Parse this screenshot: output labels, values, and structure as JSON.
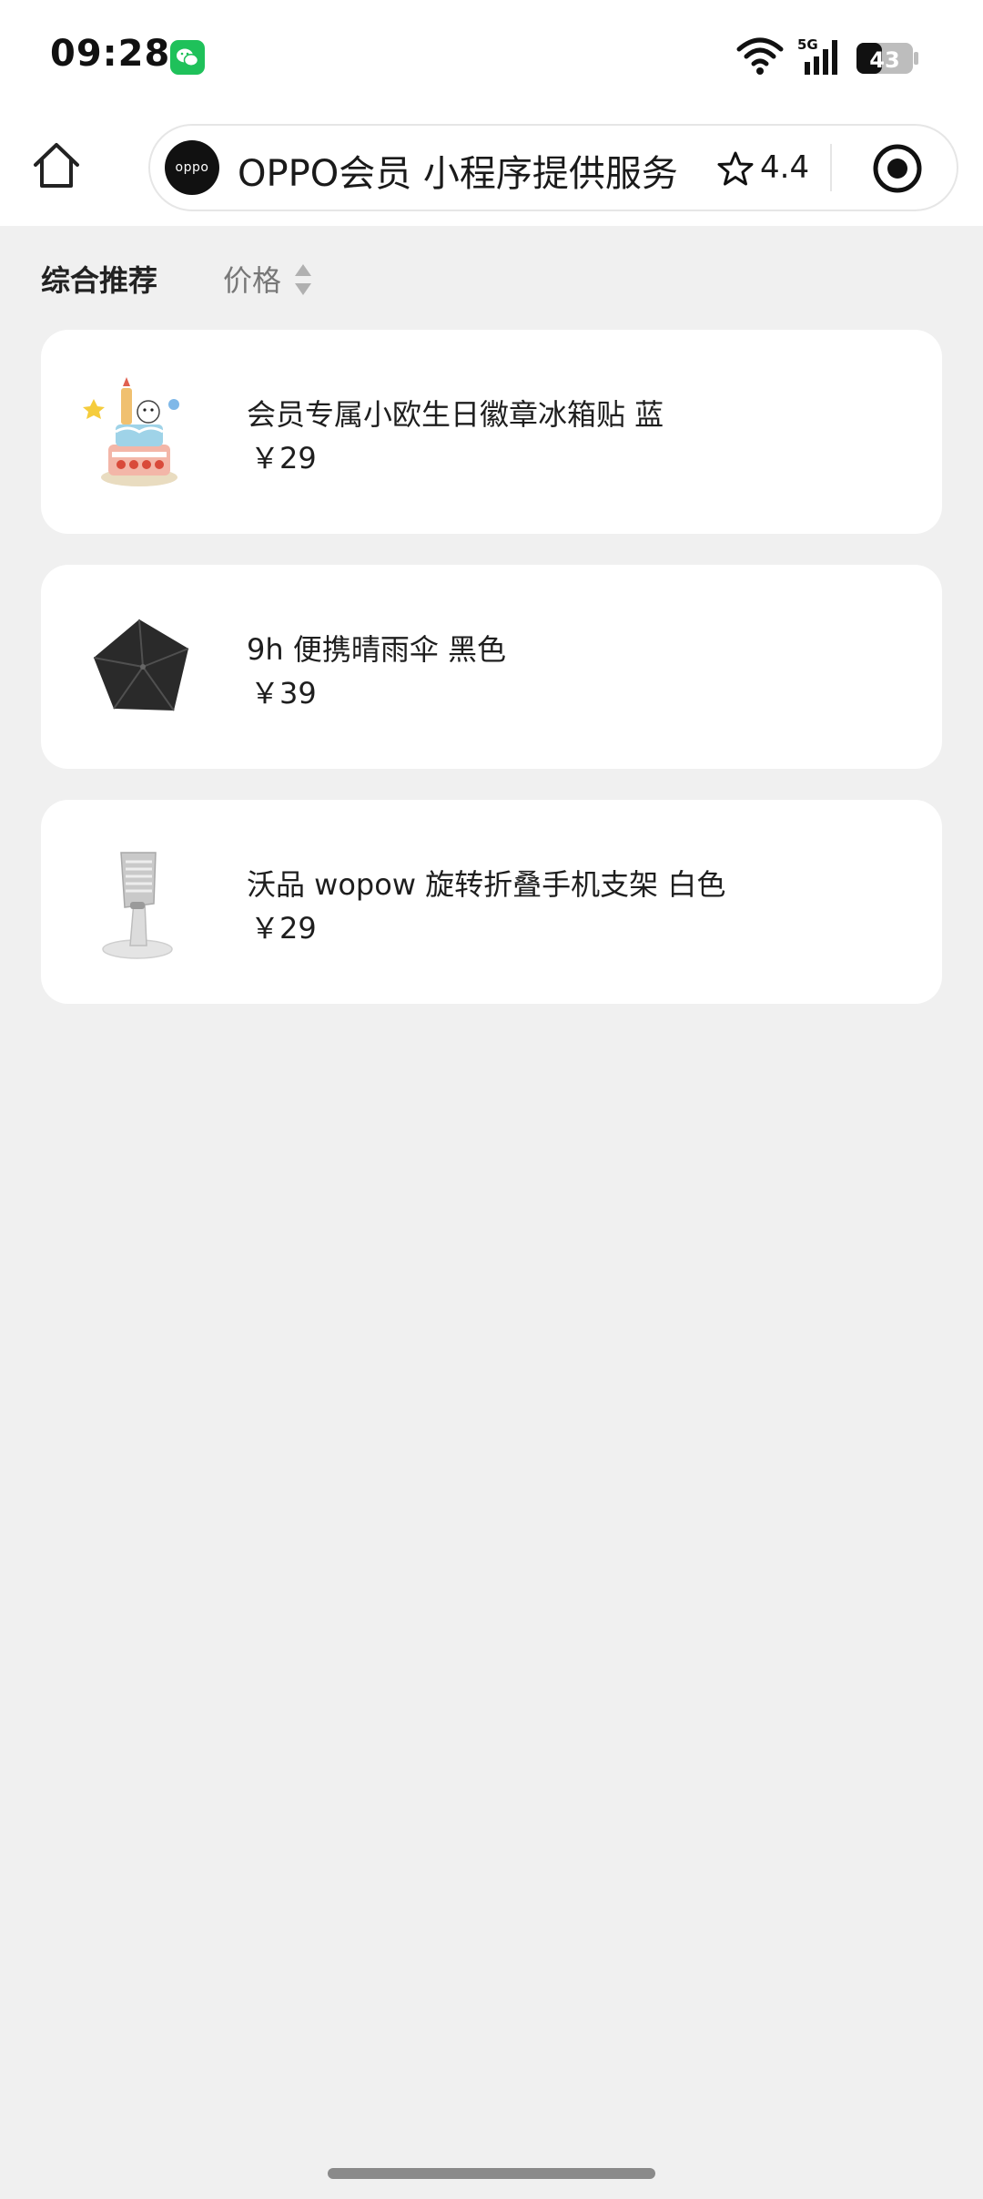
{
  "status_bar": {
    "time": "09:28",
    "network": "5G",
    "battery": "43"
  },
  "nav": {
    "logo_text": "oppo",
    "title": "OPPO会员 小程序提供服务",
    "rating": "4.4"
  },
  "sort": {
    "recommend_label": "综合推荐",
    "price_label": "价格"
  },
  "products": [
    {
      "name": "会员专属小欧生日徽章冰箱贴 蓝",
      "price": "￥29",
      "icon": "birthday-cake-magnet"
    },
    {
      "name": "9h 便携晴雨伞 黑色",
      "price": "￥39",
      "icon": "black-umbrella"
    },
    {
      "name": "沃品 wopow 旋转折叠手机支架 白色",
      "price": "￥29",
      "icon": "phone-stand"
    }
  ]
}
